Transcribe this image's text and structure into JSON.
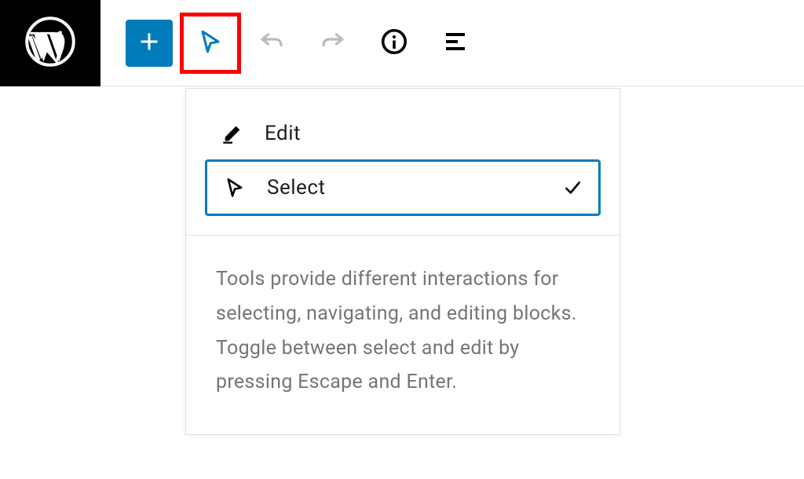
{
  "colors": {
    "primary": "#007cba",
    "highlight": "#ff0000",
    "text": "#1e1e1e",
    "muted": "#757575"
  },
  "toolbar": {
    "icons": {
      "logo": "wordpress-icon",
      "add": "plus-icon",
      "tools": "cursor-icon",
      "undo": "undo-icon",
      "redo": "redo-icon",
      "info": "info-icon",
      "outline": "list-view-icon"
    }
  },
  "dropdown": {
    "items": [
      {
        "label": "Edit",
        "icon": "pencil",
        "selected": false
      },
      {
        "label": "Select",
        "icon": "cursor",
        "selected": true
      }
    ],
    "description": "Tools provide different interactions for selecting, navigating, and editing blocks. Toggle between select and edit by pressing Escape and Enter."
  }
}
